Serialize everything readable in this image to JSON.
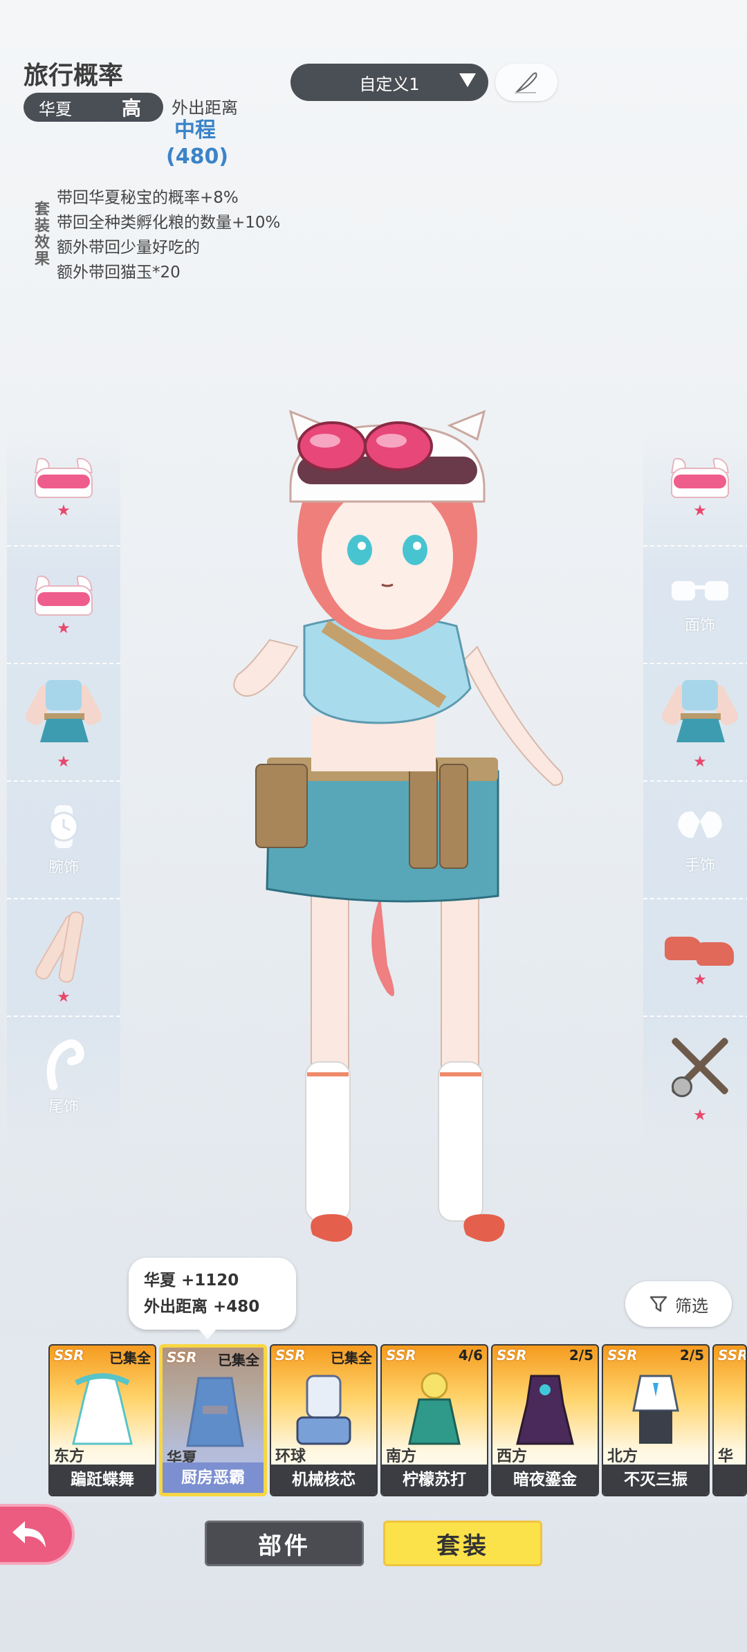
{
  "header": {
    "title": "旅行概率",
    "region": "华夏",
    "region_level": "高",
    "distance_label": "外出距离",
    "distance_value": "中程",
    "distance_number": "(480)",
    "suit_effect_label": "套装效果",
    "suit_effects": [
      "带回华夏秘宝的概率+8%",
      "带回全种类孵化粮的数量+10%",
      "额外带回少量好吃的",
      "额外带回猫玉*20"
    ]
  },
  "preset": {
    "label": "自定义1",
    "edit_icon": "quill-icon"
  },
  "left_slots": [
    {
      "type": "hat",
      "label": "",
      "equipped": true
    },
    {
      "type": "hat",
      "label": "",
      "equipped": true
    },
    {
      "type": "outfit",
      "label": "",
      "equipped": true
    },
    {
      "type": "watch",
      "label": "腕饰",
      "equipped": false
    },
    {
      "type": "legs",
      "label": "",
      "equipped": true
    },
    {
      "type": "tail",
      "label": "尾饰",
      "equipped": false
    }
  ],
  "right_slots": [
    {
      "type": "hat",
      "label": "",
      "equipped": true
    },
    {
      "type": "glasses",
      "label": "面饰",
      "equipped": false
    },
    {
      "type": "outfit",
      "label": "",
      "equipped": true
    },
    {
      "type": "gloves",
      "label": "手饰",
      "equipped": false
    },
    {
      "type": "shoes",
      "label": "",
      "equipped": true
    },
    {
      "type": "tools",
      "label": "",
      "equipped": true
    }
  ],
  "tooltip": {
    "line1": "华夏 +1120",
    "line2": "外出距离 +480"
  },
  "filter": {
    "label": "筛选"
  },
  "cards": [
    {
      "rarity": "SSR",
      "status": "已集全",
      "region": "东方",
      "name": "蹁跹蝶舞",
      "selected": false,
      "art_color": "#58c4c8"
    },
    {
      "rarity": "SSR",
      "status": "已集全",
      "region": "华夏",
      "name": "厨房恶霸",
      "selected": true,
      "art_color": "#3f8fc0"
    },
    {
      "rarity": "SSR",
      "status": "已集全",
      "region": "环球",
      "name": "机械核芯",
      "selected": false,
      "art_color": "#7aa0d8"
    },
    {
      "rarity": "SSR",
      "status": "4/6",
      "region": "南方",
      "name": "柠檬苏打",
      "selected": false,
      "art_color": "#2f9a8a"
    },
    {
      "rarity": "SSR",
      "status": "2/5",
      "region": "西方",
      "name": "暗夜鎏金",
      "selected": false,
      "art_color": "#4a2a5a"
    },
    {
      "rarity": "SSR",
      "status": "2/5",
      "region": "北方",
      "name": "不灭三振",
      "selected": false,
      "art_color": "#3a3f4a"
    },
    {
      "rarity": "SSR",
      "status": "",
      "region": "华夏",
      "name": "",
      "selected": false,
      "art_color": "#c0c8e0"
    }
  ],
  "tabs": {
    "parts": "部件",
    "suit": "套装"
  },
  "colors": {
    "accent_blue": "#3a84c8",
    "pill_dark": "#4a4e55",
    "tab_active": "#fbe24a",
    "back_pink": "#ec5c80",
    "star": "#e8476b"
  }
}
